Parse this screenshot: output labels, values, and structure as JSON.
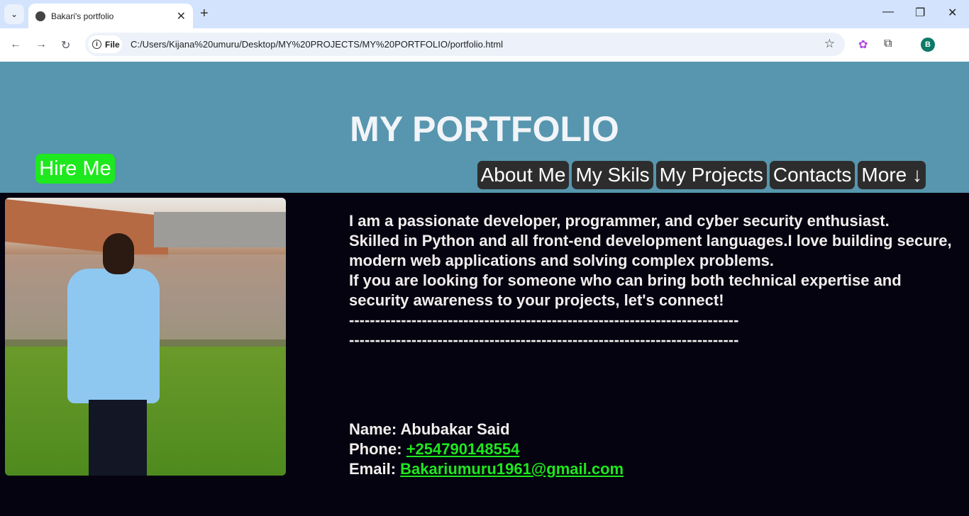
{
  "browser": {
    "tab_title": "Bakari's portfolio",
    "new_tab": "+",
    "url_chip": "File",
    "url": "C:/Users/Kijana%20umuru/Desktop/MY%20PROJECTS/MY%20PORTFOLIO/portfolio.html",
    "profile_initial": "B"
  },
  "header": {
    "title": "MY PORTFOLIO",
    "hire_button": "Hire Me",
    "menu": [
      "About Me",
      "My Skils",
      "My Projects",
      "Contacts",
      "More ↓"
    ]
  },
  "bio": {
    "lines": [
      "I am a passionate developer, programmer, and cyber security enthusiast.",
      "Skilled in Python and all front-end development languages.I love building secure, modern web applications and solving complex problems.",
      "If you are looking for someone who can bring both technical expertise and security awareness to your projects, let's connect!",
      "---------------------------------------------------------------------------",
      "---------------------------------------------------------------------------"
    ]
  },
  "contact": {
    "name_label": "Name:",
    "name": "Abubakar Said",
    "phone_label": "Phone:",
    "phone": "+254790148554",
    "email_label": "Email:",
    "email": "Bakariumuru1961@gmail.com"
  },
  "colors": {
    "header_bg": "#5796ae",
    "hire_bg": "#1ee81e",
    "page_bg": "#04030f",
    "menu_bg": "#2d2d2d"
  }
}
